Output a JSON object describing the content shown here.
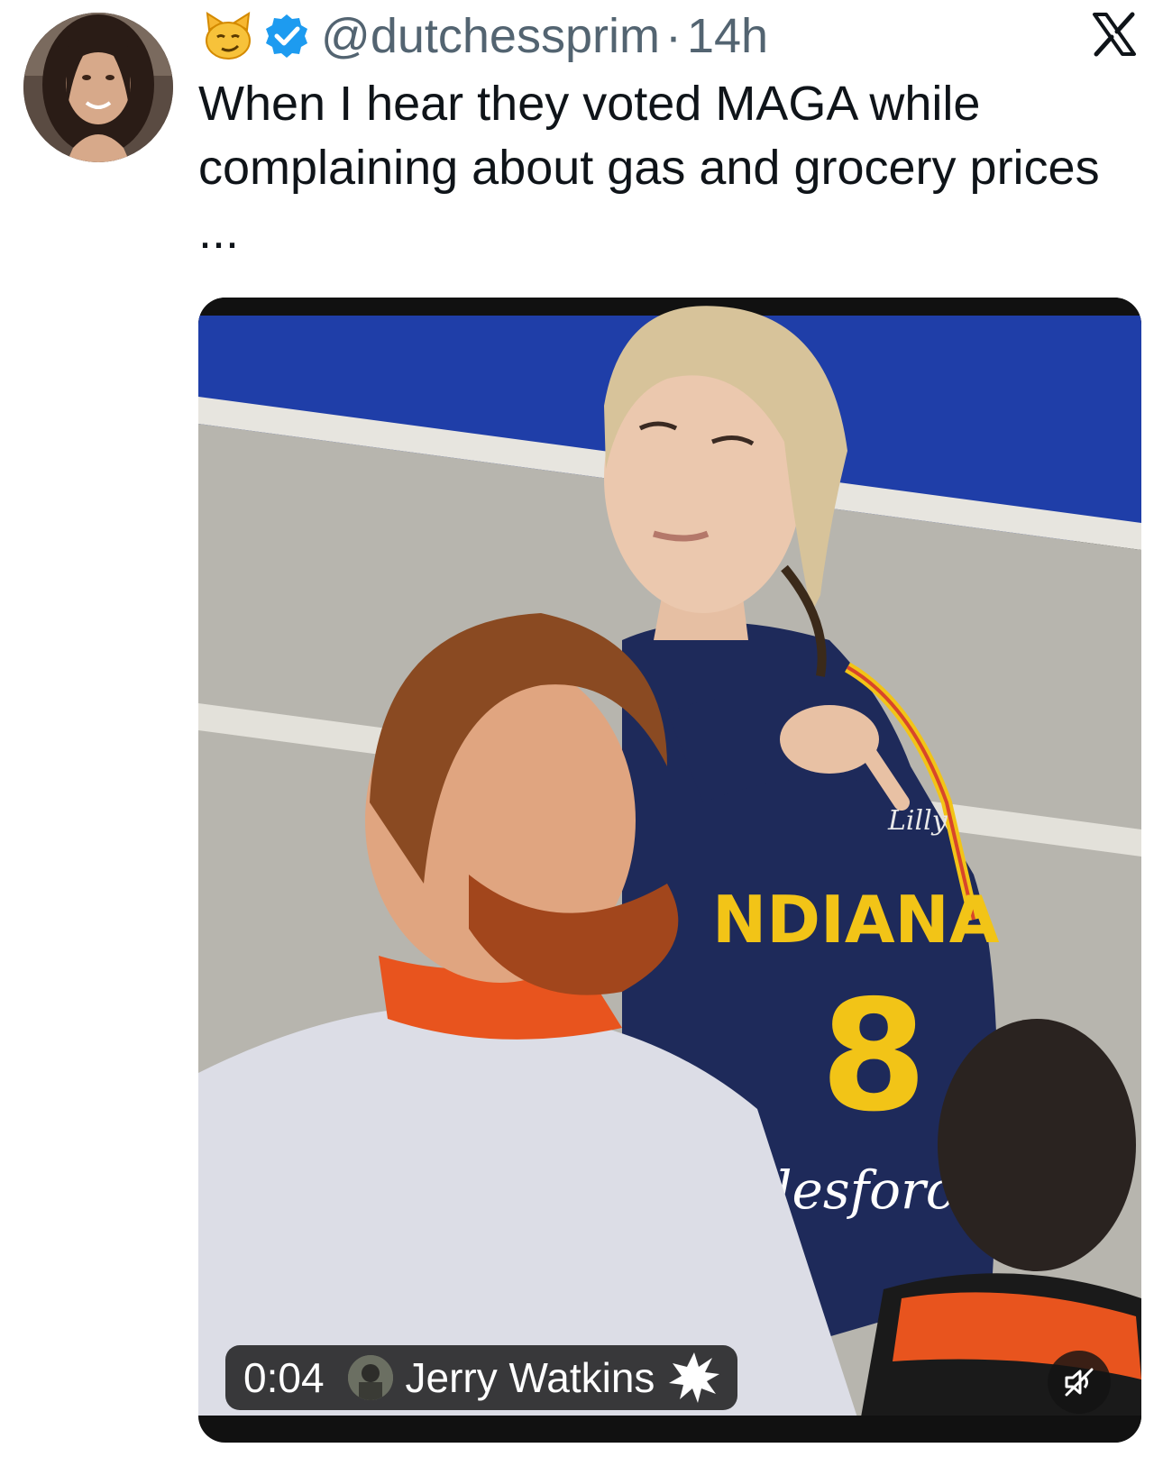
{
  "tweet": {
    "author": {
      "handle": "@dutchessprim",
      "badge_emoji_icon": "smirking-cat-icon",
      "verified_icon": "verified-badge-icon",
      "avatar_icon": "profile-avatar"
    },
    "separator": "·",
    "timestamp": "14h",
    "text": "When I hear they voted MAGA while complaining about gas and grocery prices ...",
    "platform_icon": "x-logo-icon"
  },
  "media": {
    "type": "video",
    "elapsed": "0:04",
    "attribution_name": "Jerry Watkins",
    "attribution_icon": "burst-badge-icon",
    "mute_icon": "muted-speaker-icon",
    "jersey": {
      "team": "NDIANA",
      "number": "8",
      "sponsor_top": "Lilly",
      "sponsor_bottom": "lesforce"
    }
  },
  "colors": {
    "text_primary": "#0f1419",
    "text_secondary": "#536471",
    "verified_blue": "#1d9bf0",
    "court_blue": "#1f3ea8",
    "jersey_navy": "#1e2a5a",
    "jersey_gold": "#f2c417",
    "lanyard_orange": "#e8541e"
  }
}
